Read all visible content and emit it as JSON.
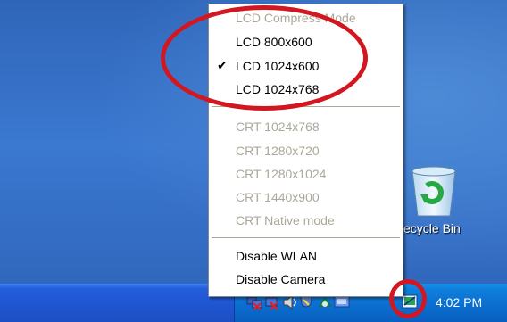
{
  "desktop": {
    "recycle_bin_label": "ecycle Bin"
  },
  "menu": {
    "items": [
      {
        "label": "LCD Compress Mode",
        "enabled": false,
        "checked": false
      },
      {
        "label": "LCD 800x600",
        "enabled": true,
        "checked": false
      },
      {
        "label": "LCD 1024x600",
        "enabled": true,
        "checked": true
      },
      {
        "label": "LCD 1024x768",
        "enabled": true,
        "checked": false
      },
      {
        "label": "CRT 1024x768",
        "enabled": false,
        "checked": false
      },
      {
        "label": "CRT 1280x720",
        "enabled": false,
        "checked": false
      },
      {
        "label": "CRT 1280x1024",
        "enabled": false,
        "checked": false
      },
      {
        "label": "CRT 1440x900",
        "enabled": false,
        "checked": false
      },
      {
        "label": "CRT Native mode",
        "enabled": false,
        "checked": false
      },
      {
        "label": "Disable WLAN",
        "enabled": true,
        "checked": false
      },
      {
        "label": "Disable Camera",
        "enabled": true,
        "checked": false
      }
    ],
    "check_glyph": "✔"
  },
  "taskbar": {
    "clock": "4:02 PM",
    "tray_icons": [
      "network-disconnected-icon",
      "wireless-disconnected-icon",
      "volume-icon",
      "security-shield-icon",
      "connection-icon",
      "screen-resolution-icon",
      "display-mode-icon"
    ]
  },
  "colors": {
    "annotation": "#d31720",
    "disabled_text": "#aca899",
    "taskbar": "#245edb",
    "tray": "#0f7fdc"
  }
}
